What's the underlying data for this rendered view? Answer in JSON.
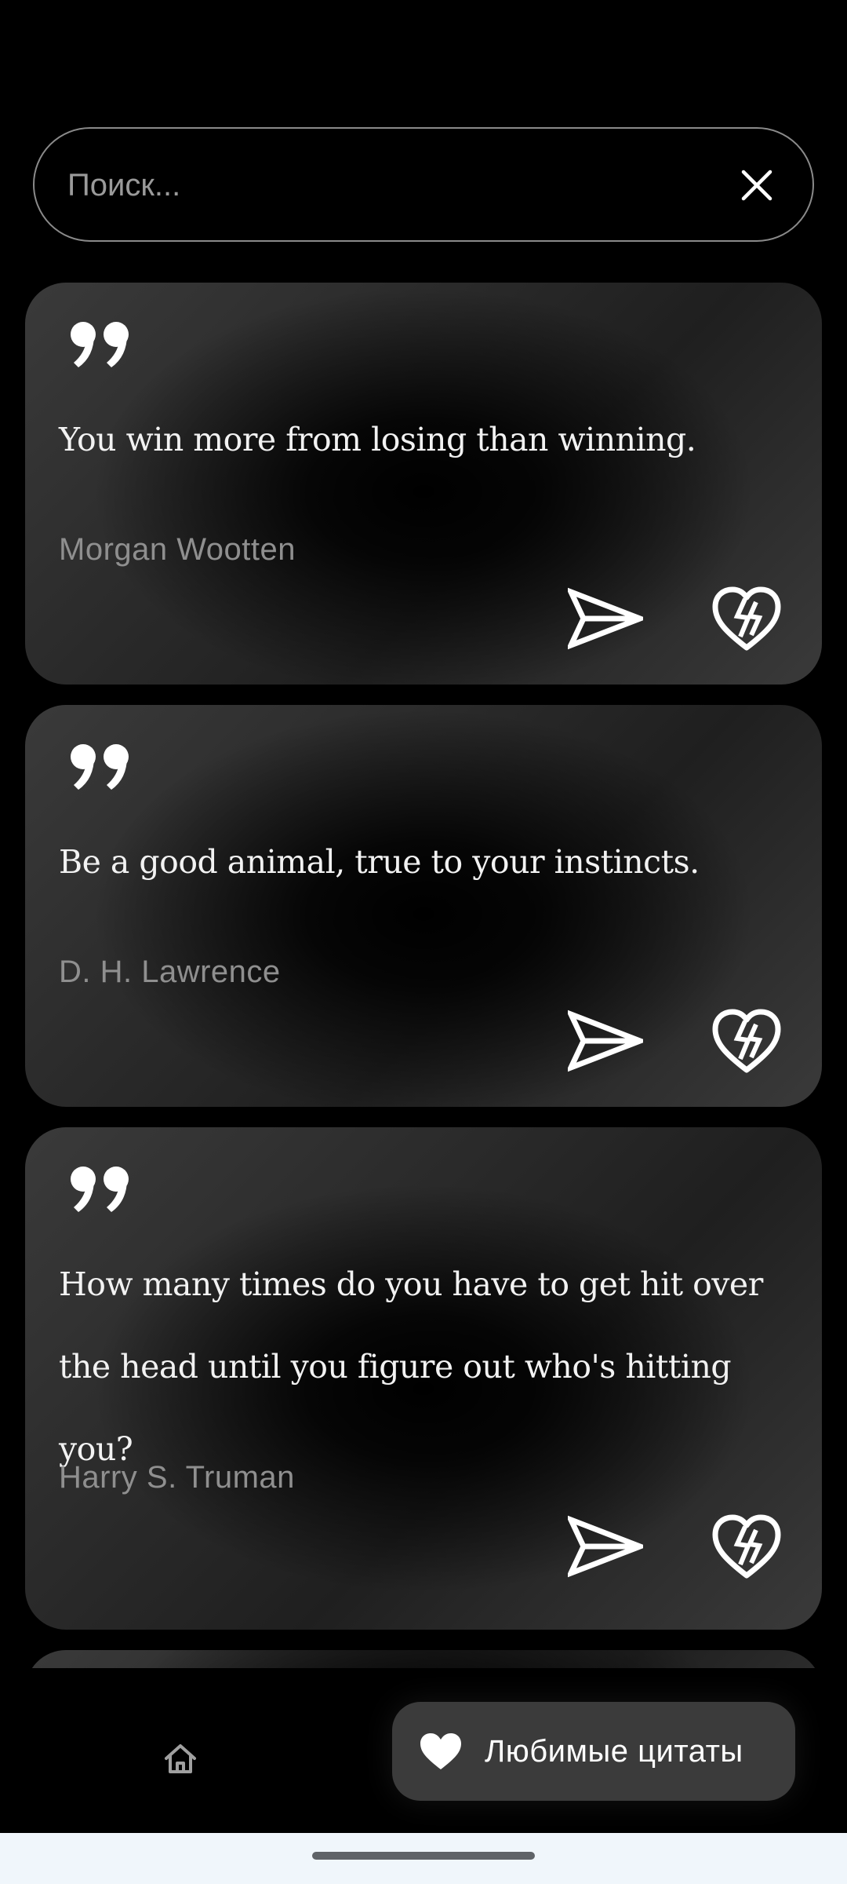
{
  "search": {
    "placeholder": "Поиск...",
    "value": ""
  },
  "quotes": [
    {
      "text": "You win more from losing than winning.",
      "author": "Morgan Wootten"
    },
    {
      "text": "Be a good animal, true to your instincts.",
      "author": "D. H. Lawrence"
    },
    {
      "text": "How many times do you have to get hit over the head until you figure out who's hitting you?",
      "author": "Harry S. Truman"
    }
  ],
  "icons": {
    "quote": "quote-mark-icon",
    "share": "send-icon",
    "unfavorite": "broken-heart-icon",
    "home": "home-icon",
    "favorites": "heart-icon",
    "clear": "close-icon"
  },
  "bottom_nav": {
    "favorites_label": "Любимые цитаты"
  },
  "colors": {
    "background": "#000000",
    "card_light": "#3a3a3a",
    "author_text": "#8f8f8f",
    "pill": "#3b3b3b",
    "gesture_bar_bg": "#f0f6fb"
  }
}
